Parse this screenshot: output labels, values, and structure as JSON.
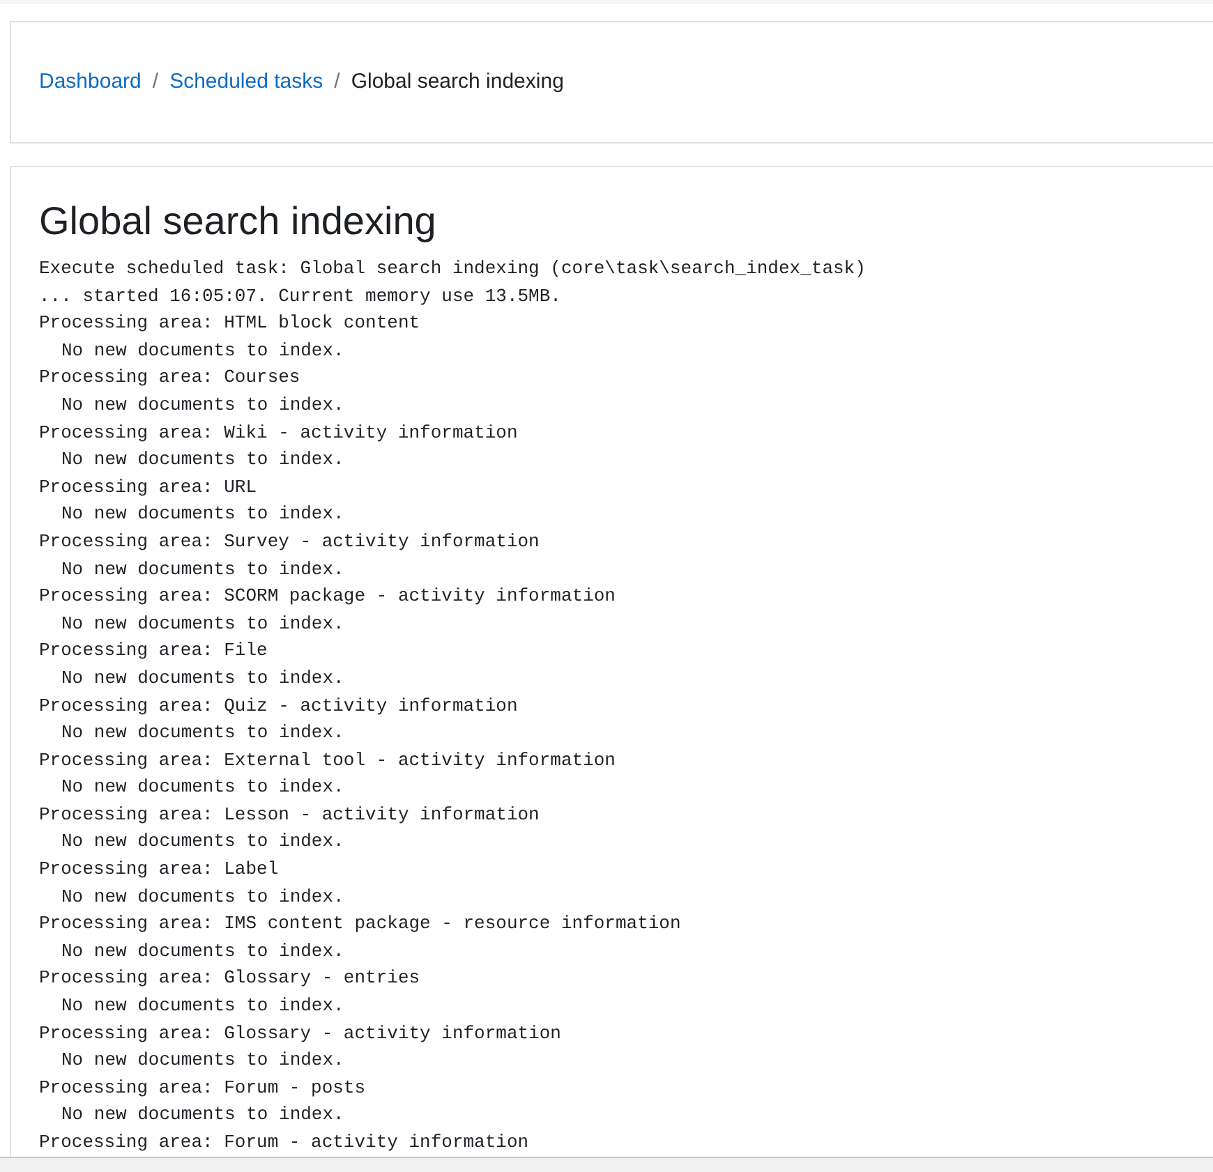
{
  "breadcrumb": [
    {
      "label": "Dashboard",
      "kind": "link"
    },
    {
      "label": "Scheduled tasks",
      "kind": "link"
    },
    {
      "label": "Global search indexing",
      "kind": "current"
    }
  ],
  "breadcrumb_separator": "/",
  "heading": "Global search indexing",
  "log": [
    {
      "kind": "header",
      "text": "Execute scheduled task: Global search indexing (core\\task\\search_index_task)"
    },
    {
      "kind": "header",
      "text": "... started 16:05:07. Current memory use 13.5MB."
    },
    {
      "kind": "area",
      "text": "Processing area: HTML block content"
    },
    {
      "kind": "result",
      "text": "No new documents to index."
    },
    {
      "kind": "area",
      "text": "Processing area: Courses"
    },
    {
      "kind": "result",
      "text": "No new documents to index."
    },
    {
      "kind": "area",
      "text": "Processing area: Wiki - activity information"
    },
    {
      "kind": "result",
      "text": "No new documents to index."
    },
    {
      "kind": "area",
      "text": "Processing area: URL"
    },
    {
      "kind": "result",
      "text": "No new documents to index."
    },
    {
      "kind": "area",
      "text": "Processing area: Survey - activity information"
    },
    {
      "kind": "result",
      "text": "No new documents to index."
    },
    {
      "kind": "area",
      "text": "Processing area: SCORM package - activity information"
    },
    {
      "kind": "result",
      "text": "No new documents to index."
    },
    {
      "kind": "area",
      "text": "Processing area: File"
    },
    {
      "kind": "result",
      "text": "No new documents to index."
    },
    {
      "kind": "area",
      "text": "Processing area: Quiz - activity information"
    },
    {
      "kind": "result",
      "text": "No new documents to index."
    },
    {
      "kind": "area",
      "text": "Processing area: External tool - activity information"
    },
    {
      "kind": "result",
      "text": "No new documents to index."
    },
    {
      "kind": "area",
      "text": "Processing area: Lesson - activity information"
    },
    {
      "kind": "result",
      "text": "No new documents to index."
    },
    {
      "kind": "area",
      "text": "Processing area: Label"
    },
    {
      "kind": "result",
      "text": "No new documents to index."
    },
    {
      "kind": "area",
      "text": "Processing area: IMS content package - resource information"
    },
    {
      "kind": "result",
      "text": "No new documents to index."
    },
    {
      "kind": "area",
      "text": "Processing area: Glossary - entries"
    },
    {
      "kind": "result",
      "text": "No new documents to index."
    },
    {
      "kind": "area",
      "text": "Processing area: Glossary - activity information"
    },
    {
      "kind": "result",
      "text": "No new documents to index."
    },
    {
      "kind": "area",
      "text": "Processing area: Forum - posts"
    },
    {
      "kind": "result",
      "text": "No new documents to index."
    },
    {
      "kind": "area",
      "text": "Processing area: Forum - activity information"
    }
  ]
}
